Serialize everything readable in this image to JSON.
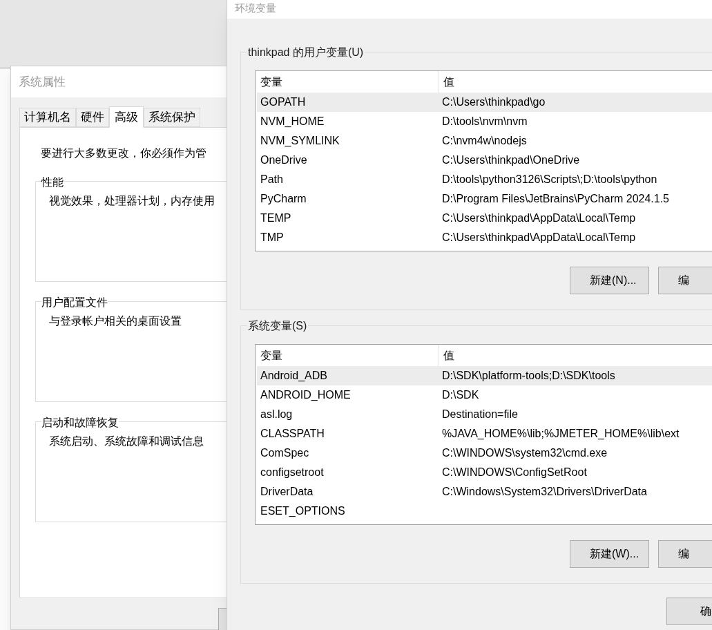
{
  "system_properties": {
    "title": "系统属性",
    "tabs": [
      {
        "label": "计算机名",
        "selected": false
      },
      {
        "label": "硬件",
        "selected": false
      },
      {
        "label": "高级",
        "selected": true
      },
      {
        "label": "系统保护",
        "selected": false
      }
    ],
    "notice": "要进行大多数更改，你必须作为管",
    "groups": [
      {
        "title": "性能",
        "description": "视觉效果，处理器计划，内存使用"
      },
      {
        "title": "用户配置文件",
        "description": "与登录帐户相关的桌面设置"
      },
      {
        "title": "启动和故障恢复",
        "description": "系统启动、系统故障和调试信息"
      }
    ]
  },
  "environment_variables": {
    "title": "环境变量",
    "sections": [
      {
        "title": "thinkpad 的用户变量(U)",
        "columns": [
          "变量",
          "值"
        ],
        "rows": [
          {
            "name": "GOPATH",
            "value": "C:\\Users\\thinkpad\\go",
            "selected": true
          },
          {
            "name": "NVM_HOME",
            "value": "D:\\tools\\nvm\\nvm",
            "selected": false
          },
          {
            "name": "NVM_SYMLINK",
            "value": "C:\\nvm4w\\nodejs",
            "selected": false
          },
          {
            "name": "OneDrive",
            "value": "C:\\Users\\thinkpad\\OneDrive",
            "selected": false
          },
          {
            "name": "Path",
            "value": "D:\\tools\\python3126\\Scripts\\;D:\\tools\\python",
            "selected": false
          },
          {
            "name": "PyCharm",
            "value": "D:\\Program Files\\JetBrains\\PyCharm 2024.1.5",
            "selected": false
          },
          {
            "name": "TEMP",
            "value": "C:\\Users\\thinkpad\\AppData\\Local\\Temp",
            "selected": false
          },
          {
            "name": "TMP",
            "value": "C:\\Users\\thinkpad\\AppData\\Local\\Temp",
            "selected": false
          }
        ],
        "buttons": [
          "新建(N)...",
          "编"
        ]
      },
      {
        "title": "系统变量(S)",
        "columns": [
          "变量",
          "值"
        ],
        "rows": [
          {
            "name": "Android_ADB",
            "value": "D:\\SDK\\platform-tools;D:\\SDK\\tools",
            "selected": true
          },
          {
            "name": "ANDROID_HOME",
            "value": "D:\\SDK",
            "selected": false
          },
          {
            "name": "asl.log",
            "value": "Destination=file",
            "selected": false
          },
          {
            "name": "CLASSPATH",
            "value": "%JAVA_HOME%\\lib;%JMETER_HOME%\\lib\\ext",
            "selected": false
          },
          {
            "name": "ComSpec",
            "value": "C:\\WINDOWS\\system32\\cmd.exe",
            "selected": false
          },
          {
            "name": "configsetroot",
            "value": "C:\\WINDOWS\\ConfigSetRoot",
            "selected": false
          },
          {
            "name": "DriverData",
            "value": "C:\\Windows\\System32\\Drivers\\DriverData",
            "selected": false
          },
          {
            "name": "ESET_OPTIONS",
            "selected": false
          }
        ],
        "buttons": [
          "新建(W)...",
          "编"
        ]
      }
    ],
    "footer_buttons": [
      "确"
    ]
  }
}
